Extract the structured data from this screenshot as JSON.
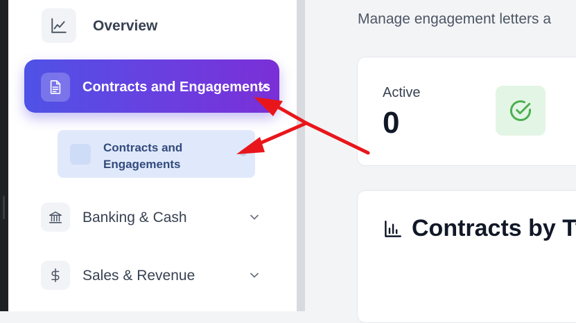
{
  "sidebar": {
    "overview": {
      "label": "Overview",
      "icon": "line-chart-icon"
    },
    "contracts": {
      "label": "Contracts and Engagements",
      "icon": "document-icon",
      "expanded": true
    },
    "contracts_sub": {
      "label_line1": "Contracts and",
      "label_line2": "Engagements"
    },
    "banking": {
      "label": "Banking & Cash",
      "icon": "bank-icon"
    },
    "sales": {
      "label": "Sales & Revenue",
      "icon": "dollar-icon"
    }
  },
  "main": {
    "subtitle": "Manage engagement letters a",
    "stat": {
      "label": "Active",
      "value": "0",
      "icon": "check-circle-icon"
    },
    "chart_card": {
      "title": "Contracts by Ty",
      "icon": "bar-chart-icon"
    }
  },
  "colors": {
    "accent_start": "#4f52e6",
    "accent_end": "#7a2fd6",
    "annotation": "#e8161b",
    "success": "#4caf50"
  }
}
